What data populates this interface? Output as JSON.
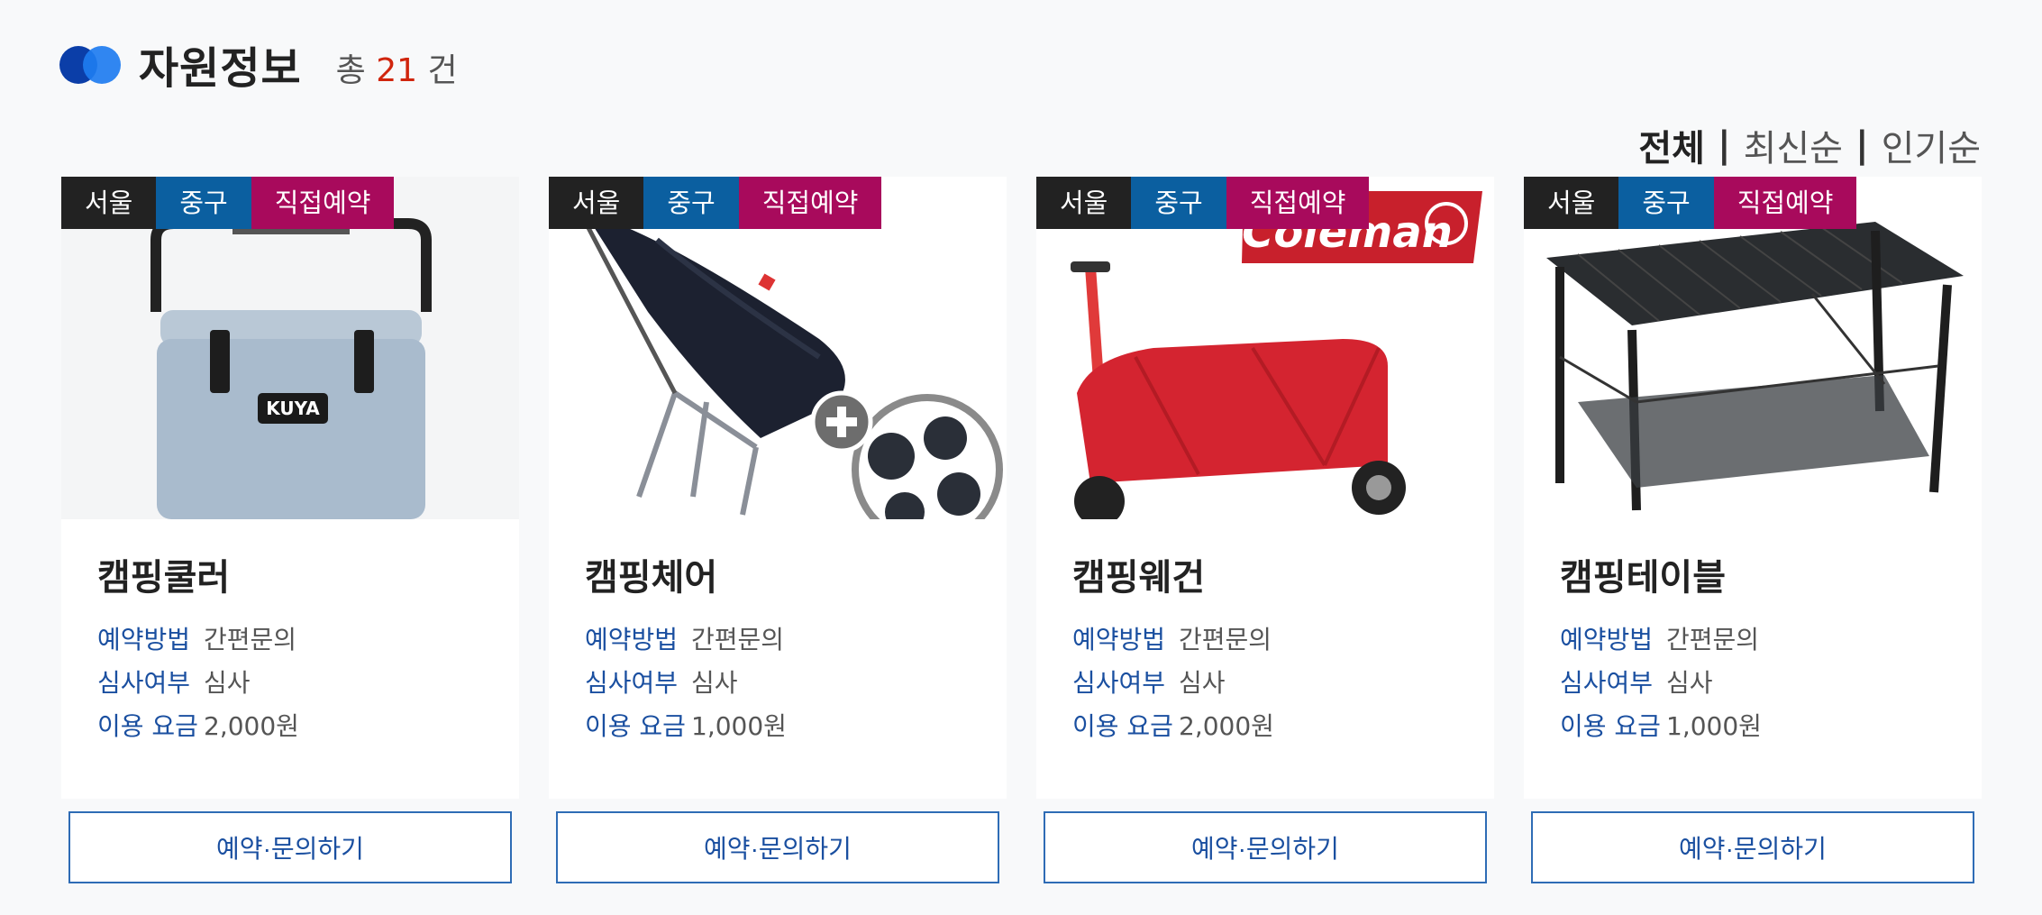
{
  "header": {
    "title": "자원정보",
    "count_prefix": "총",
    "count": "21",
    "count_suffix": "건"
  },
  "sort": {
    "all": "전체",
    "latest": "최신순",
    "popular": "인기순",
    "separator": "|"
  },
  "labels": {
    "method": "예약방법",
    "review": "심사여부",
    "fee": "이용 요금",
    "button": "예약·문의하기"
  },
  "items": [
    {
      "region": "서울",
      "district": "중구",
      "reserve_type": "직접예약",
      "name": "캠핑쿨러",
      "method": "간편문의",
      "review": "심사",
      "fee": "2,000원",
      "product_label": "KUYA"
    },
    {
      "region": "서울",
      "district": "중구",
      "reserve_type": "직접예약",
      "name": "캠핑체어",
      "method": "간편문의",
      "review": "심사",
      "fee": "1,000원"
    },
    {
      "region": "서울",
      "district": "중구",
      "reserve_type": "직접예약",
      "name": "캠핑웨건",
      "method": "간편문의",
      "review": "심사",
      "fee": "2,000원",
      "product_label": "Coleman"
    },
    {
      "region": "서울",
      "district": "중구",
      "reserve_type": "직접예약",
      "name": "캠핑테이블",
      "method": "간편문의",
      "review": "심사",
      "fee": "1,000원"
    }
  ]
}
